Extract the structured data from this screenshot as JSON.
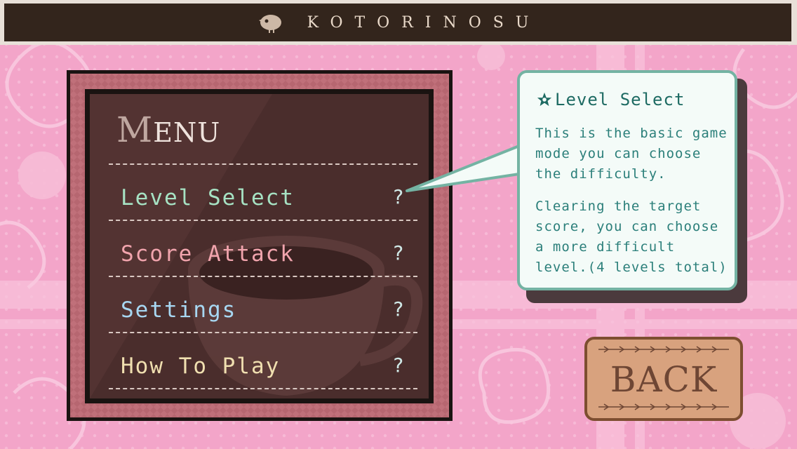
{
  "header": {
    "title": "KOTORINOSU"
  },
  "menu": {
    "title_initial": "M",
    "title_rest": "ENU",
    "items": [
      {
        "label": "Level Select",
        "help": "?",
        "color": "#a6e2c3"
      },
      {
        "label": "Score Attack",
        "help": "?",
        "color": "#f1a4ad"
      },
      {
        "label": "Settings",
        "help": "?",
        "color": "#a7d7f2"
      },
      {
        "label": "How To Play",
        "help": "?",
        "color": "#f0dfb0"
      }
    ]
  },
  "tooltip": {
    "heading": "Level Select",
    "paragraph1": "This is the basic game mode you can choose the difficulty.",
    "paragraph2": "Clearing the target score, you can choose a more difficult level.(4 levels total)"
  },
  "back_button": {
    "label": "BACK"
  },
  "colors": {
    "background_pink": "#f4a9cc",
    "top_bar": "#33251c",
    "board_panel": "#4a2d2c",
    "bubble_border": "#74b3a3",
    "back_button": "#d8a27e"
  }
}
